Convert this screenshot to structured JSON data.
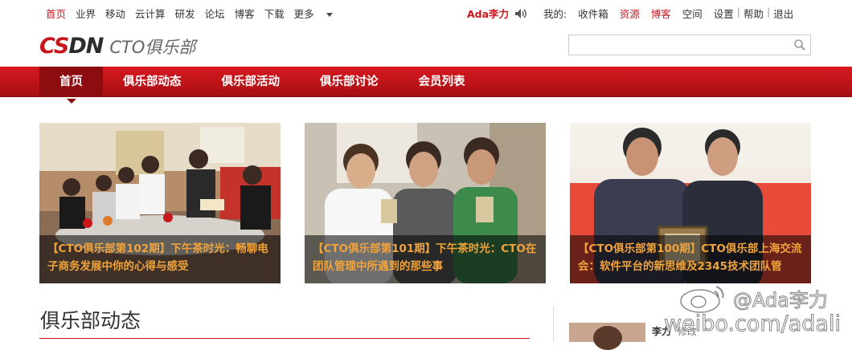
{
  "topnav": {
    "items": [
      "首页",
      "业界",
      "移动",
      "云计算",
      "研发",
      "论坛",
      "博客",
      "下载"
    ],
    "more": "更多"
  },
  "user": {
    "name": "Ada李力",
    "mine_label": "我的:",
    "links": [
      "收件箱",
      "资源",
      "博客",
      "空间",
      "设置"
    ],
    "help": "帮助",
    "logout": "退出"
  },
  "logo": {
    "brand_cs": "CS",
    "brand_dn": "DN",
    "subtitle": "CTO俱乐部"
  },
  "search": {
    "placeholder": ""
  },
  "mainnav": {
    "items": [
      "首页",
      "俱乐部动态",
      "俱乐部活动",
      "俱乐部讨论",
      "会员列表"
    ]
  },
  "features": [
    {
      "caption": "【CTO俱乐部第102期】下午茶时光：畅聊电子商务发展中你的心得与感受"
    },
    {
      "caption": "【CTO俱乐部第101期】下午茶时光：CTO在团队管理中所遇到的那些事"
    },
    {
      "caption": "【CTO俱乐部第100期】CTO俱乐部上海交流会：软件平台的新思维及2345技术团队管"
    }
  ],
  "section": {
    "title": "俱乐部动态"
  },
  "member": {
    "name": "李力",
    "role": "修改"
  },
  "watermark": {
    "handle": "@Ada李力",
    "url": "weibo.com/adali"
  },
  "colors": {
    "brand_red": "#c8161d",
    "caption_orange": "#f1a33c"
  }
}
